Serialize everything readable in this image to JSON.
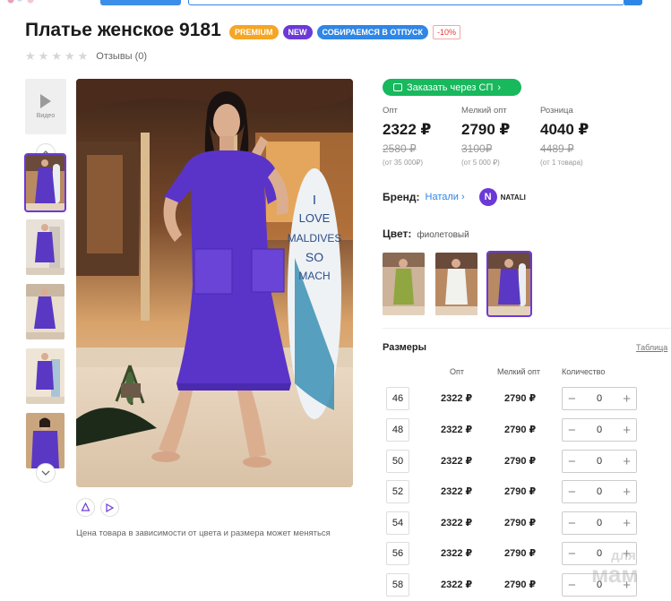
{
  "product": {
    "title": "Платье женское 9181",
    "badges": [
      "PREMIUM",
      "NEW",
      "СОБИРАЕМСЯ В ОТПУСК",
      "-10%"
    ],
    "reviews_label": "Отзывы (0)",
    "rating_stars": 0
  },
  "gallery": {
    "video_label": "Видео",
    "price_note": "Цена товара в зависимости от цвета и размера может меняться"
  },
  "order": {
    "sp_button": "Заказать через СП",
    "prices": [
      {
        "label": "Опт",
        "value": "2322 ₽",
        "old": "2580 ₽",
        "from": "(от 35 000₽)"
      },
      {
        "label": "Мелкий опт",
        "value": "2790 ₽",
        "old": "3100₽",
        "from": "(от 5 000 ₽)"
      },
      {
        "label": "Розница",
        "value": "4040 ₽",
        "old": "4489 ₽",
        "from": "(от 1 товара)"
      }
    ],
    "brand_label": "Бренд:",
    "brand_name": "Натали",
    "brand_logo_letter": "N",
    "brand_logo_text": "NATALI",
    "color_label": "Цвет:",
    "color_value": "фиолетовый"
  },
  "sizes": {
    "title": "Размеры",
    "table_link": "Таблица",
    "headers": {
      "opt": "Опт",
      "small": "Мелкий опт",
      "qty": "Количество"
    },
    "rows": [
      {
        "size": "46",
        "opt": "2322 ₽",
        "small": "2790 ₽",
        "qty": "0"
      },
      {
        "size": "48",
        "opt": "2322 ₽",
        "small": "2790 ₽",
        "qty": "0"
      },
      {
        "size": "50",
        "opt": "2322 ₽",
        "small": "2790 ₽",
        "qty": "0"
      },
      {
        "size": "52",
        "opt": "2322 ₽",
        "small": "2790 ₽",
        "qty": "0"
      },
      {
        "size": "54",
        "opt": "2322 ₽",
        "small": "2790 ₽",
        "qty": "0"
      },
      {
        "size": "56",
        "opt": "2322 ₽",
        "small": "2790 ₽",
        "qty": "0"
      },
      {
        "size": "58",
        "opt": "2322 ₽",
        "small": "2790 ₽",
        "qty": "0"
      }
    ]
  },
  "watermark": {
    "line1": "для",
    "line2": "мам"
  },
  "colors": {
    "accent": "#6c39d8",
    "premium": "#f5a623",
    "vacation": "#2f86e6",
    "sp_green": "#18b85d",
    "discount": "#e53935"
  }
}
